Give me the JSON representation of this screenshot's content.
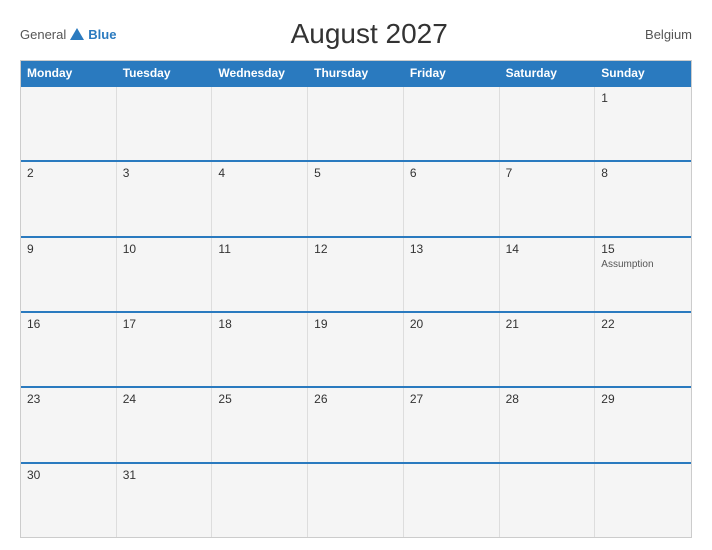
{
  "header": {
    "logo": {
      "general": "General",
      "blue": "Blue",
      "triangle_title": "GeneralBlue Logo"
    },
    "title": "August 2027",
    "country": "Belgium"
  },
  "days_of_week": [
    "Monday",
    "Tuesday",
    "Wednesday",
    "Thursday",
    "Friday",
    "Saturday",
    "Sunday"
  ],
  "weeks": [
    [
      {
        "day": "",
        "event": ""
      },
      {
        "day": "",
        "event": ""
      },
      {
        "day": "",
        "event": ""
      },
      {
        "day": "",
        "event": ""
      },
      {
        "day": "",
        "event": ""
      },
      {
        "day": "",
        "event": ""
      },
      {
        "day": "1",
        "event": ""
      }
    ],
    [
      {
        "day": "2",
        "event": ""
      },
      {
        "day": "3",
        "event": ""
      },
      {
        "day": "4",
        "event": ""
      },
      {
        "day": "5",
        "event": ""
      },
      {
        "day": "6",
        "event": ""
      },
      {
        "day": "7",
        "event": ""
      },
      {
        "day": "8",
        "event": ""
      }
    ],
    [
      {
        "day": "9",
        "event": ""
      },
      {
        "day": "10",
        "event": ""
      },
      {
        "day": "11",
        "event": ""
      },
      {
        "day": "12",
        "event": ""
      },
      {
        "day": "13",
        "event": ""
      },
      {
        "day": "14",
        "event": ""
      },
      {
        "day": "15",
        "event": "Assumption"
      }
    ],
    [
      {
        "day": "16",
        "event": ""
      },
      {
        "day": "17",
        "event": ""
      },
      {
        "day": "18",
        "event": ""
      },
      {
        "day": "19",
        "event": ""
      },
      {
        "day": "20",
        "event": ""
      },
      {
        "day": "21",
        "event": ""
      },
      {
        "day": "22",
        "event": ""
      }
    ],
    [
      {
        "day": "23",
        "event": ""
      },
      {
        "day": "24",
        "event": ""
      },
      {
        "day": "25",
        "event": ""
      },
      {
        "day": "26",
        "event": ""
      },
      {
        "day": "27",
        "event": ""
      },
      {
        "day": "28",
        "event": ""
      },
      {
        "day": "29",
        "event": ""
      }
    ],
    [
      {
        "day": "30",
        "event": ""
      },
      {
        "day": "31",
        "event": ""
      },
      {
        "day": "",
        "event": ""
      },
      {
        "day": "",
        "event": ""
      },
      {
        "day": "",
        "event": ""
      },
      {
        "day": "",
        "event": ""
      },
      {
        "day": "",
        "event": ""
      }
    ]
  ]
}
